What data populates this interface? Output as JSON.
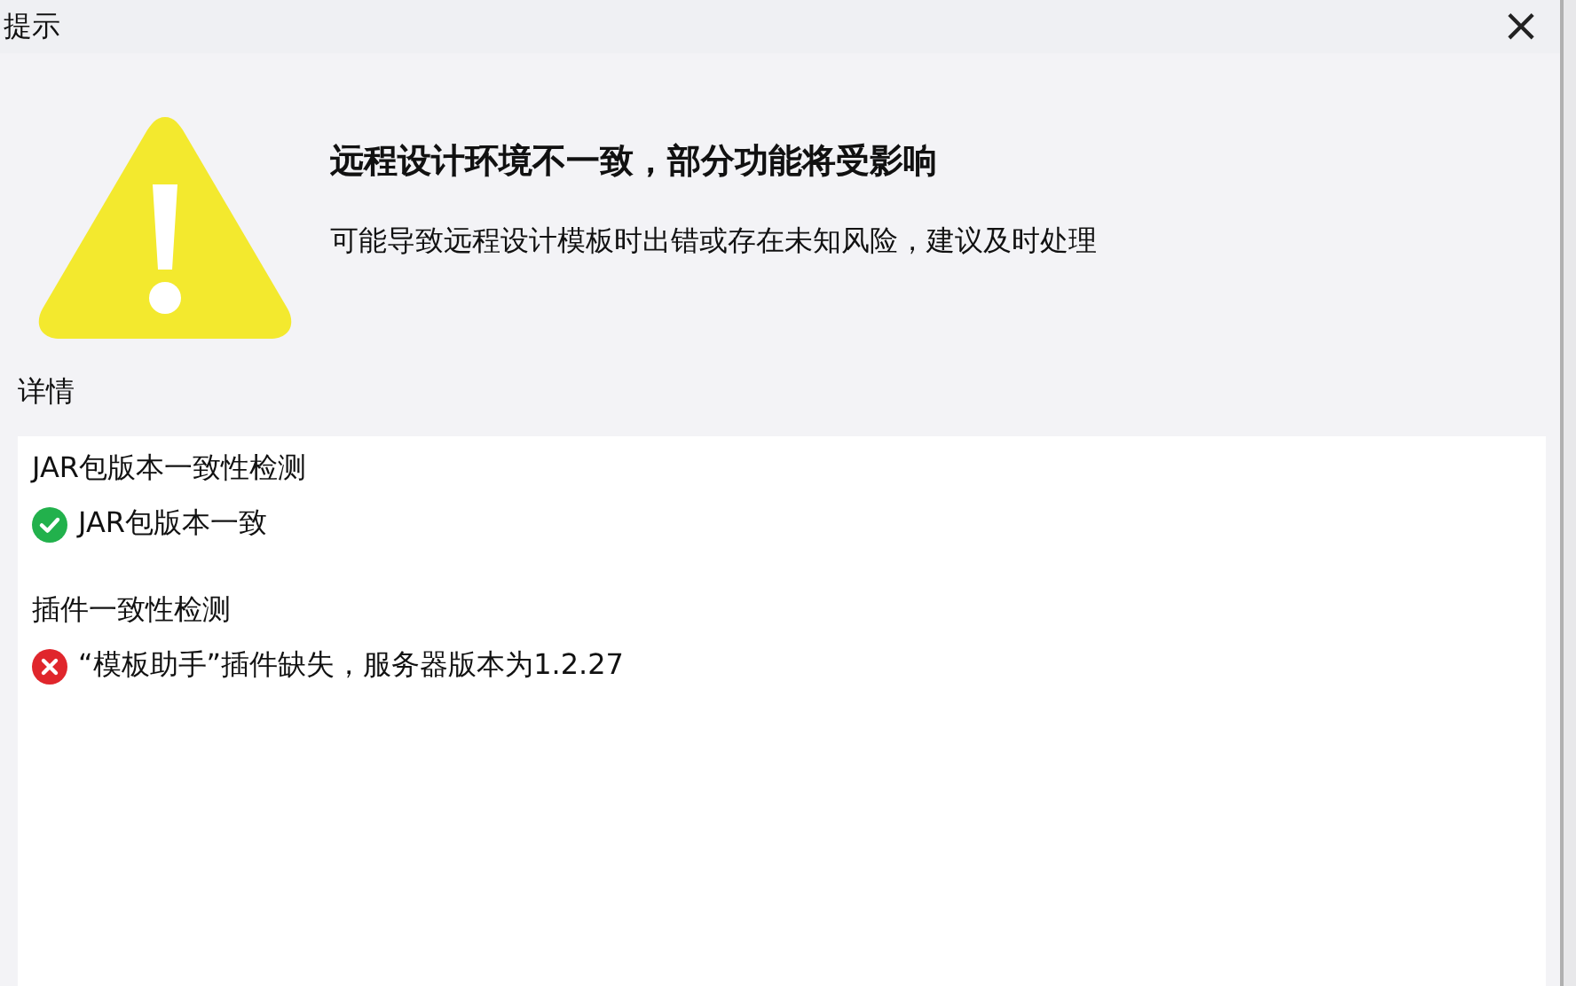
{
  "window": {
    "title": "提示",
    "close": "×"
  },
  "heading": "远程设计环境不一致，部分功能将受影响",
  "message": "可能导致远程设计模板时出错或存在未知风险，建议及时处理",
  "details_label": "详情",
  "checks": [
    {
      "title": "JAR包版本一致性检测",
      "result": {
        "kind": "pass",
        "text": "JAR包版本一致"
      }
    },
    {
      "title": "插件一致性检测",
      "result": {
        "kind": "fail",
        "text": "“模板助手”插件缺失，服务器版本为1.2.27"
      }
    }
  ]
}
